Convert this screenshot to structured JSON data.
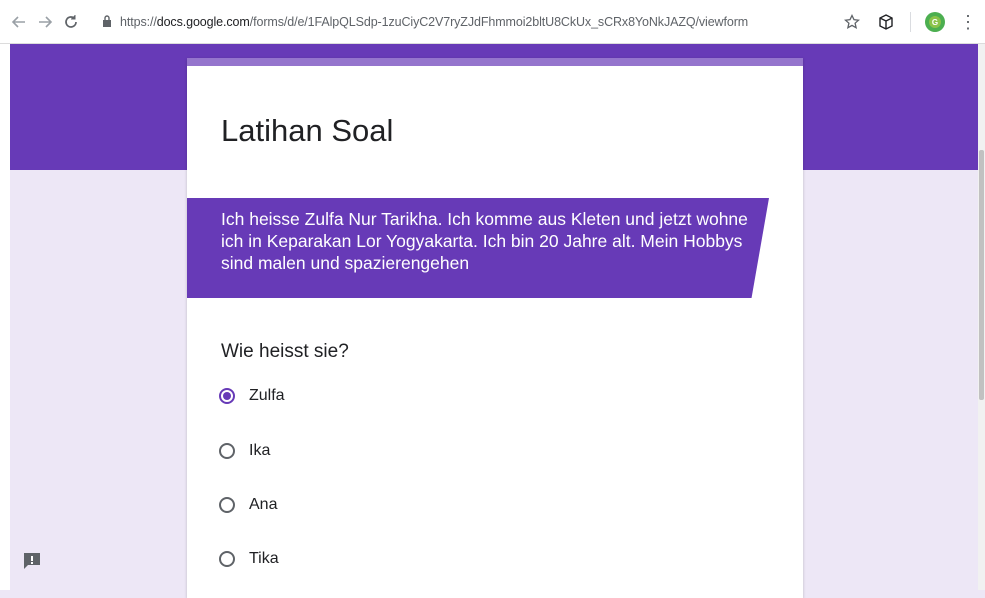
{
  "browser": {
    "url_scheme": "https://",
    "url_host": "docs.google.com",
    "url_path": "/forms/d/e/1FAlpQLSdp-1zuCiyC2V7ryZJdFhmmoi2bltU8CkUx_sCRx8YoNkJAZQ/viewform",
    "profile_initial": "G"
  },
  "form": {
    "title": "Latihan Soal",
    "description": "Ich heisse Zulfa Nur Tarikha. Ich komme aus Kleten und jetzt wohne ich in Keparakan Lor Yogyakarta. Ich bin 20 Jahre alt. Mein Hobbys sind malen und spazierengehen",
    "question": "Wie heisst sie?",
    "options": [
      {
        "label": "Zulfa",
        "selected": true
      },
      {
        "label": "Ika",
        "selected": false
      },
      {
        "label": "Ana",
        "selected": false
      },
      {
        "label": "Tika",
        "selected": false
      }
    ]
  },
  "colors": {
    "accent": "#673ab7",
    "accent_light": "#9575cd",
    "background": "#ede7f6"
  },
  "icons": [
    "back-arrow-icon",
    "forward-arrow-icon",
    "reload-icon",
    "lock-icon",
    "star-icon",
    "extension-cube-icon",
    "profile-avatar-icon",
    "menu-kebab-icon",
    "feedback-icon"
  ]
}
